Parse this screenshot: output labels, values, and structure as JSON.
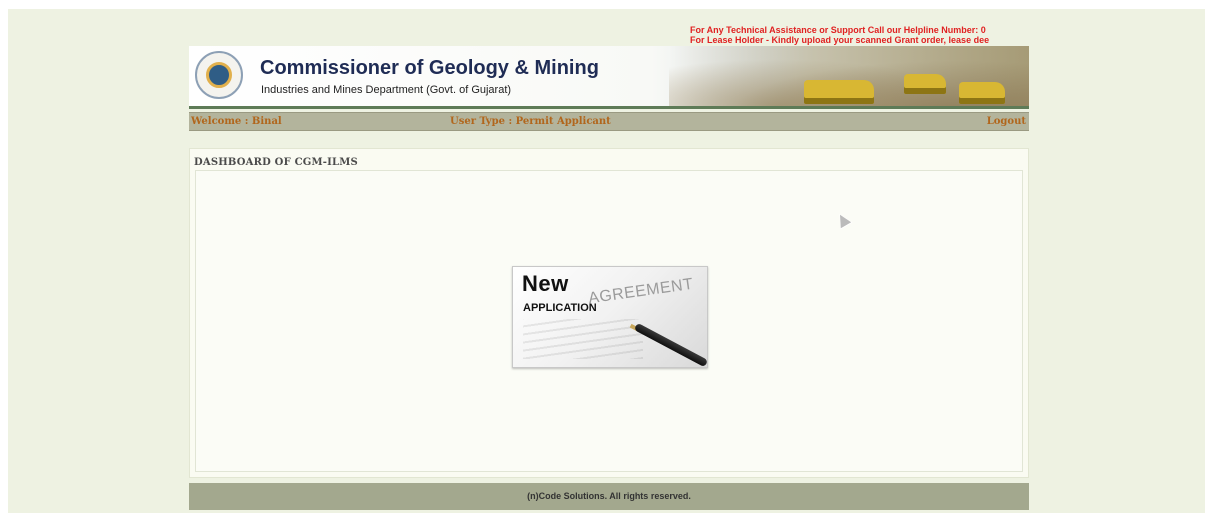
{
  "notices": [
    "For Any Technical Assistance or Support Call our Helpline Number: 0",
    "For Lease Holder - Kindly upload your scanned Grant order, lease dee"
  ],
  "header": {
    "title": "Commissioner of Geology & Mining",
    "subtitle": "Industries and Mines Department (Govt. of Gujarat)"
  },
  "userbar": {
    "welcome": "Welcome : Binal",
    "user_type": "User Type : Permit Applicant",
    "logout": "Logout"
  },
  "dashboard": {
    "title": "DASHBOARD OF CGM-ILMS",
    "card": {
      "new_label": "New",
      "application_label": "APPLICATION",
      "background_text": "AGREEMENT"
    }
  },
  "footer": {
    "text": "(n)Code Solutions. All rights reserved."
  }
}
